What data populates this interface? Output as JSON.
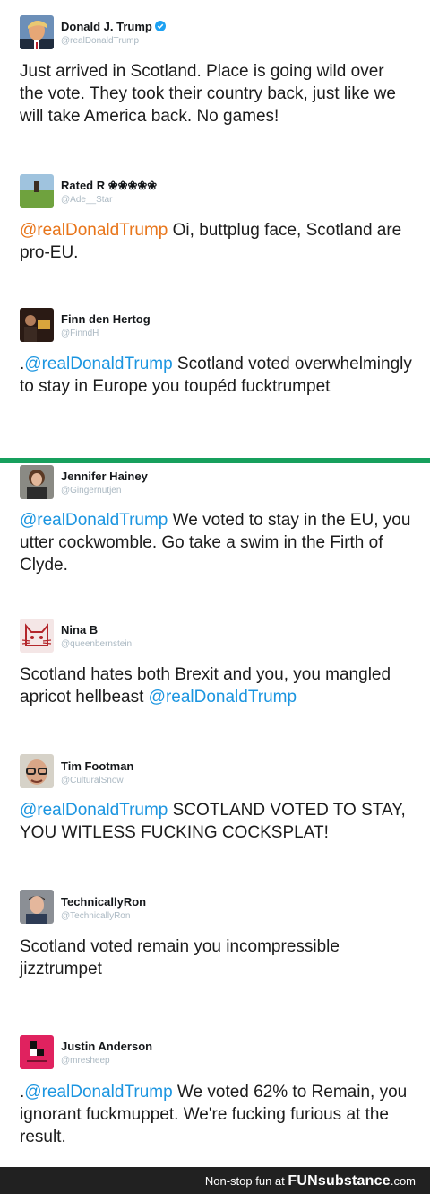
{
  "colors": {
    "mention": "#1b95e0",
    "mention_alt": "#e8751a",
    "divider": "#17a05d",
    "footer_bg": "#212121"
  },
  "tweets": [
    {
      "name": "Donald J. Trump",
      "handle": "@realDonaldTrump",
      "verified": true,
      "prefix": "",
      "mention": "",
      "text": "Just arrived in Scotland. Place is going wild over the vote. They took their country back, just like we will take America back. No games!"
    },
    {
      "name": "Rated R ❀❀❀❀❀",
      "handle": "@Ade__Star",
      "prefix": "",
      "mention": "@realDonaldTrump",
      "text": " Oi, buttplug face, Scotland are pro-EU."
    },
    {
      "name": "Finn den Hertog",
      "handle": "@FinndH",
      "prefix": ".",
      "mention": "@realDonaldTrump",
      "text": " Scotland voted overwhelmingly to stay in Europe you toupéd fucktrumpet"
    },
    {
      "name": "Jennifer Hainey",
      "handle": "@Gingernutjen",
      "prefix": "",
      "mention": "@realDonaldTrump",
      "text": " We voted to stay in the EU, you utter cockwomble. Go take a swim in the Firth of Clyde."
    },
    {
      "name": "Nina B",
      "handle": "@queenbernstein",
      "prefix": "",
      "text": "Scotland hates both Brexit and you, you mangled apricot hellbeast ",
      "mention_after": "@realDonaldTrump"
    },
    {
      "name": "Tim Footman",
      "handle": "@CulturalSnow",
      "prefix": "",
      "mention": "@realDonaldTrump",
      "text": " SCOTLAND VOTED TO STAY, YOU WITLESS FUCKING COCKSPLAT!"
    },
    {
      "name": "TechnicallyRon",
      "handle": "@TechnicallyRon",
      "prefix": "",
      "mention": "",
      "text": "Scotland voted remain you incompressible jizztrumpet"
    },
    {
      "name": "Justin Anderson",
      "handle": "@mresheep",
      "prefix": ".",
      "mention": "@realDonaldTrump",
      "text": " We voted 62% to Remain, you ignorant fuckmuppet. We're fucking furious at the result."
    }
  ],
  "footer": {
    "tagline": "Non-stop fun at",
    "brand_fun": "FUN",
    "brand_rest": "substance",
    "brand_tld": ".com"
  }
}
